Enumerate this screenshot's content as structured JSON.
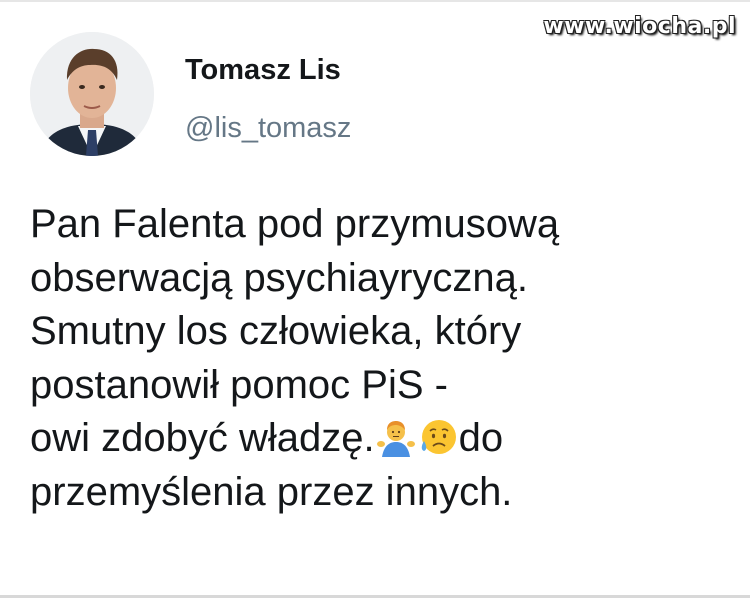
{
  "watermark": "www.wiocha.pl",
  "author": {
    "display_name": "Tomasz Lis",
    "handle": "@lis_tomasz",
    "avatar_icon": "profile-photo"
  },
  "tweet": {
    "line1": "Pan Falenta pod przymusową",
    "line2": "obserwacją psychiayryczną.",
    "line3": "Smutny los człowieka, który",
    "line4": "postanowił pomoc PiS -",
    "line5_before": "owi zdobyć władzę.",
    "line5_after": "do",
    "line6": "przemyślenia przez innych.",
    "emojis": [
      "man-shrugging-icon",
      "sad-but-relieved-face-icon"
    ]
  },
  "colors": {
    "text": "#14171a",
    "handle": "#657786",
    "background": "#ffffff"
  }
}
